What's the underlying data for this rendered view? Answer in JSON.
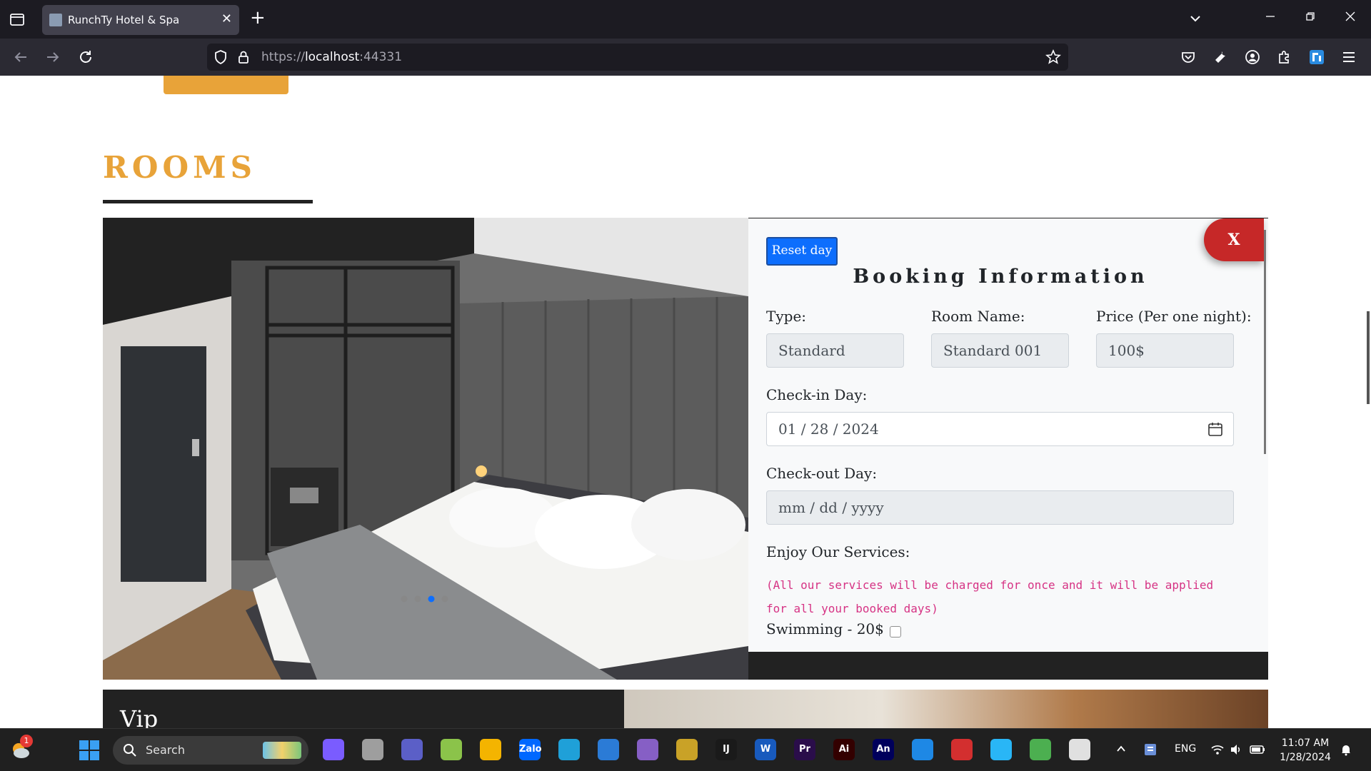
{
  "browser": {
    "tab_title": "RunchTy Hotel & Spa",
    "tab_close": "✕",
    "new_tab": "+",
    "url_scheme": "https://",
    "url_host": "localhost",
    "url_port": ":44331"
  },
  "page": {
    "section_title": "ROOMS",
    "booking": {
      "reset_label": "Reset day",
      "close_label": "X",
      "title": "Booking Information",
      "type_label": "Type:",
      "type_value": "Standard",
      "room_name_label": "Room Name:",
      "room_name_value": "Standard 001",
      "price_label": "Price (Per one night):",
      "price_value": "100$",
      "checkin_label": "Check-in Day:",
      "checkin_value": "01 / 28 / 2024",
      "checkout_label": "Check-out Day:",
      "checkout_placeholder": "mm / dd / yyyy",
      "services_label": "Enjoy Our Services:",
      "services_note": "(All our services will be charged for once and it will be applied for all your booked days)",
      "service_swimming": "Swimming - 20$",
      "accent_color": "#0d6efd",
      "close_color": "#c62828",
      "note_color": "#d63384"
    },
    "next_room_title": "Vip",
    "accent_gold": "#e8a339"
  },
  "taskbar": {
    "search_label": "Search",
    "badge_count": "1",
    "apps": [
      {
        "name": "copilot-icon",
        "label": "",
        "color": "#7a5cff"
      },
      {
        "name": "task-view-icon",
        "label": "",
        "color": "#9e9e9e"
      },
      {
        "name": "teams-chat-icon",
        "label": "",
        "color": "#5b5fc7"
      },
      {
        "name": "green-app-icon",
        "label": "",
        "color": "#8bc34a"
      },
      {
        "name": "file-explorer-icon",
        "label": "",
        "color": "#f4b400"
      },
      {
        "name": "zalo-icon",
        "label": "Zalo",
        "color": "#0068ff"
      },
      {
        "name": "edge-icon",
        "label": "",
        "color": "#1fa0d8"
      },
      {
        "name": "firefox-icon",
        "label": "",
        "color": "#2b7bd6"
      },
      {
        "name": "visual-studio-icon",
        "label": "",
        "color": "#865fc5"
      },
      {
        "name": "sticky-tool-icon",
        "label": "",
        "color": "#c9a227"
      },
      {
        "name": "intellij-icon",
        "label": "IJ",
        "color": "#1a1a1a"
      },
      {
        "name": "word-icon",
        "label": "W",
        "color": "#185abd"
      },
      {
        "name": "premiere-icon",
        "label": "Pr",
        "color": "#2a0d4a"
      },
      {
        "name": "illustrator-icon",
        "label": "Ai",
        "color": "#330000"
      },
      {
        "name": "animate-icon",
        "label": "An",
        "color": "#00005b"
      },
      {
        "name": "vscode-icon",
        "label": "",
        "color": "#1e88e5"
      },
      {
        "name": "red-app-icon",
        "label": "",
        "color": "#d32f2f"
      },
      {
        "name": "elephant-app-icon",
        "label": "",
        "color": "#29b6f6"
      },
      {
        "name": "chrome-icon",
        "label": "",
        "color": "#4caf50"
      },
      {
        "name": "snipping-tool-icon",
        "label": "",
        "color": "#e0e0e0"
      }
    ],
    "tray_lang": "ENG",
    "time": "11:07 AM",
    "date": "1/28/2024"
  }
}
